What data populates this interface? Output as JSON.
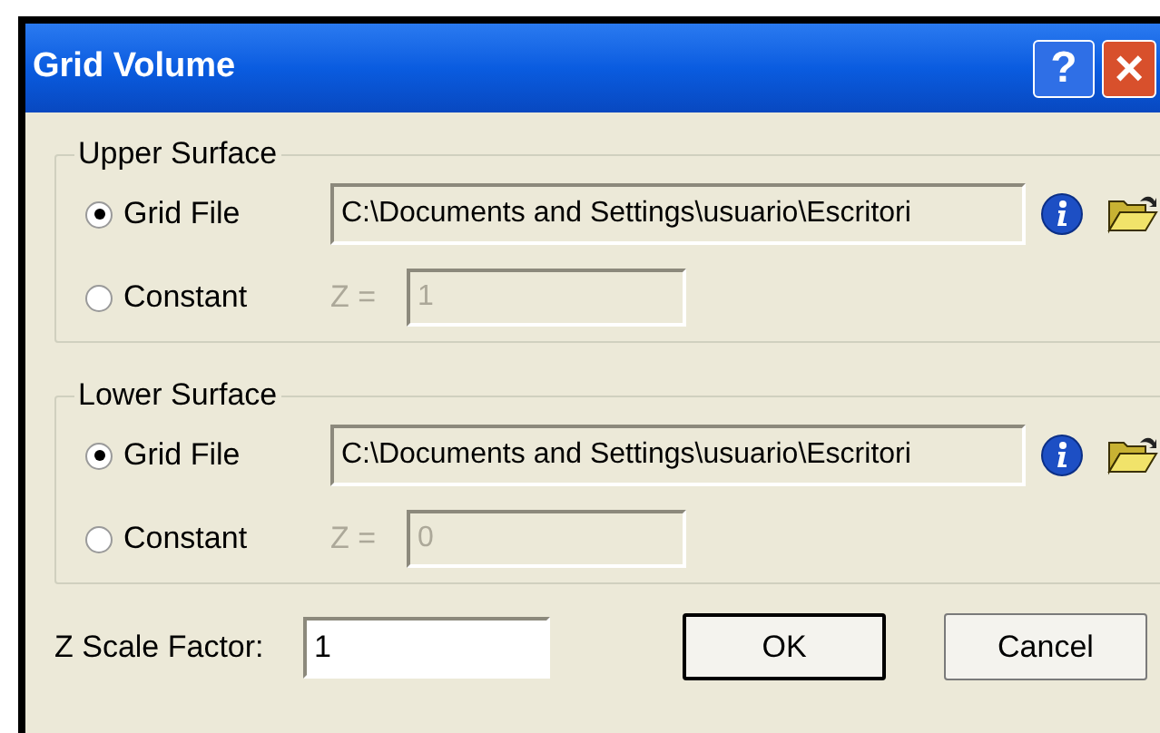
{
  "window": {
    "title": "Grid Volume",
    "help_button": "?",
    "close_button": "×"
  },
  "surfaces": [
    {
      "label": "Upper Surface",
      "options": [
        {
          "kind": "file",
          "label": "Grid File",
          "selected": true,
          "value": "C:\\Documents and Settings\\usuario\\Escritori"
        },
        {
          "kind": "constant",
          "label": "Constant",
          "selected": false,
          "prefix": "Z =",
          "value": "1"
        }
      ]
    },
    {
      "label": "Lower Surface",
      "options": [
        {
          "kind": "file",
          "label": "Grid File",
          "selected": true,
          "value": "C:\\Documents and Settings\\usuario\\Escritori"
        },
        {
          "kind": "constant",
          "label": "Constant",
          "selected": false,
          "prefix": "Z =",
          "value": "0"
        }
      ]
    }
  ],
  "scale_factor": {
    "label": "Z Scale Factor:",
    "value": "1"
  },
  "buttons": [
    "OK",
    "Cancel"
  ]
}
